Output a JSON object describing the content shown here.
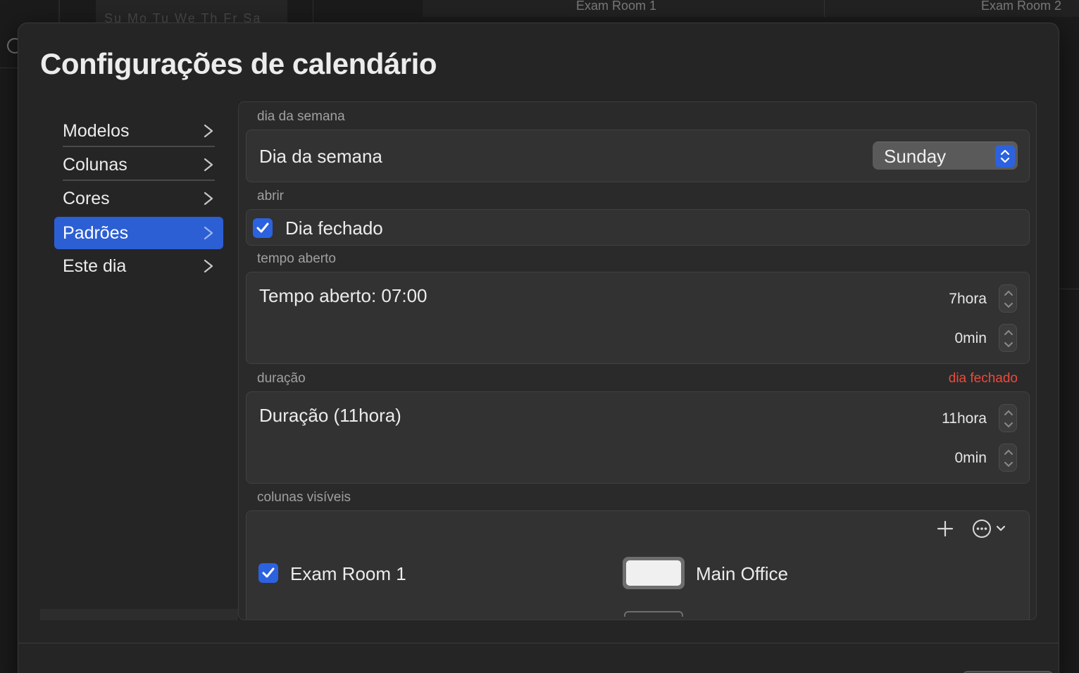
{
  "background": {
    "calendar_weekdays": "Su Mo Tu We Th Fr Sa",
    "columns": [
      "Exam Room 1",
      "Exam Room 2"
    ]
  },
  "dialog": {
    "title": "Configurações de calendário"
  },
  "sidebar": {
    "items": [
      {
        "label": "Modelos"
      },
      {
        "label": "Colunas"
      },
      {
        "label": "Cores"
      },
      {
        "label": "Padrões",
        "selected": true
      },
      {
        "label": "Este dia"
      }
    ]
  },
  "sections": {
    "weekday": {
      "label": "dia da semana",
      "title": "Dia da semana",
      "selected_value": "Sunday"
    },
    "open": {
      "label": "abrir",
      "checkbox_label": "Dia fechado",
      "checked": true
    },
    "open_time": {
      "label": "tempo aberto",
      "title": "Tempo aberto: 07:00",
      "hours": "7hora",
      "minutes": "0min"
    },
    "duration": {
      "label": "duração",
      "warning": "dia fechado",
      "title": "Duração (11hora)",
      "hours": "11hora",
      "minutes": "0min"
    },
    "visible_columns": {
      "label": "colunas visíveis",
      "rows": [
        {
          "name": "Exam Room 1",
          "checked": true,
          "location": "Main Office"
        }
      ]
    }
  },
  "colors": {
    "accent": "#2c62e0",
    "selected_sidebar": "#2c5fd4",
    "warning": "#ea4b3c"
  }
}
